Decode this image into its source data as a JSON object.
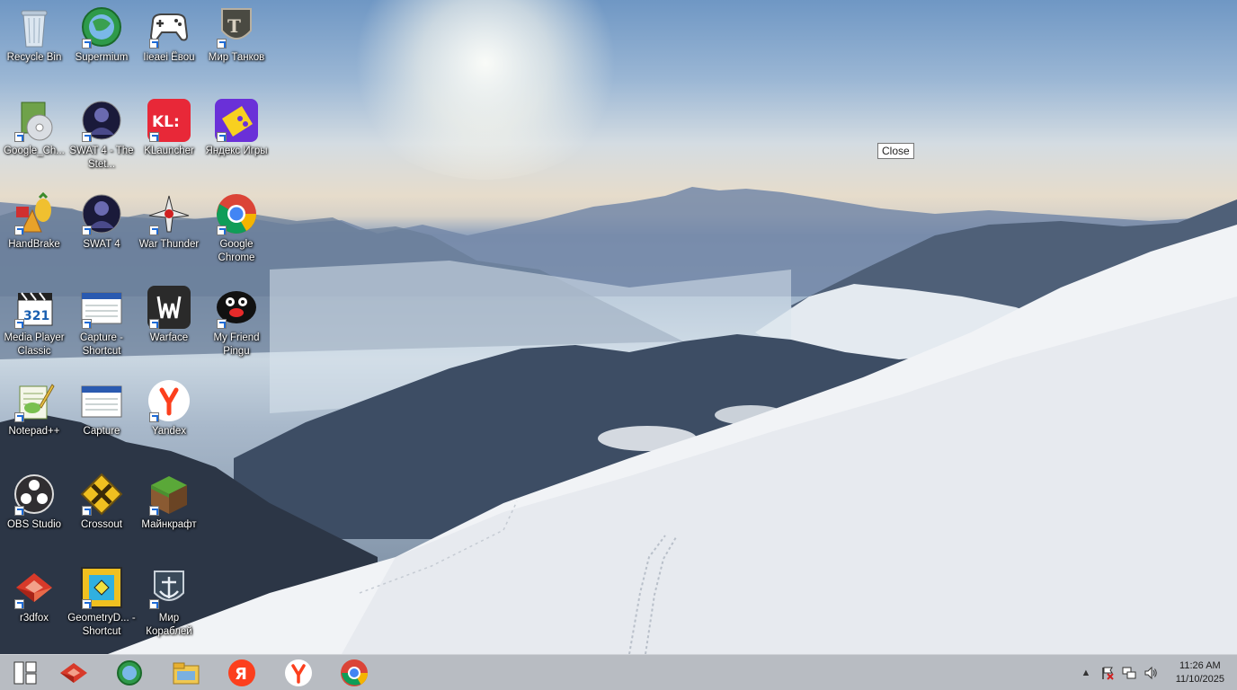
{
  "desktop": {
    "tooltip": "Close",
    "icons": [
      {
        "name": "Recycle Bin",
        "glyph": "recycle"
      },
      {
        "name": "Supermium",
        "glyph": "globe"
      },
      {
        "name": "Ііеаеі Ёвоu",
        "glyph": "gamepad"
      },
      {
        "name": "Мир Танков",
        "glyph": "tank"
      },
      {
        "name": "Google_Ch...",
        "glyph": "setup"
      },
      {
        "name": "SWAT 4 - The Stet...",
        "glyph": "swat"
      },
      {
        "name": "KLauncher",
        "glyph": "kl"
      },
      {
        "name": "Яндекс Игры",
        "glyph": "yagames"
      },
      {
        "name": "HandBrake",
        "glyph": "handbrake"
      },
      {
        "name": "SWAT 4",
        "glyph": "swat"
      },
      {
        "name": "War Thunder",
        "glyph": "warthunder"
      },
      {
        "name": "Google Chrome",
        "glyph": "chrome"
      },
      {
        "name": "Media Player Classic",
        "glyph": "mpc"
      },
      {
        "name": "Capture - Shortcut",
        "glyph": "window"
      },
      {
        "name": "Warface",
        "glyph": "warface"
      },
      {
        "name": "My Friend Pingu",
        "glyph": "pingu"
      },
      {
        "name": "Notepad++",
        "glyph": "notepad"
      },
      {
        "name": "Capture",
        "glyph": "window"
      },
      {
        "name": "Yandex",
        "glyph": "yandex"
      },
      {
        "name": "OBS Studio",
        "glyph": "obs"
      },
      {
        "name": "Crossout",
        "glyph": "crossout"
      },
      {
        "name": "Майнкрафт",
        "glyph": "minecraft"
      },
      {
        "name": "r3dfox",
        "glyph": "r3dfox"
      },
      {
        "name": "GeometryD... - Shortcut",
        "glyph": "geometry"
      },
      {
        "name": "Мир Кораблей",
        "glyph": "ships"
      }
    ]
  },
  "taskbar": {
    "items": [
      {
        "name": "start",
        "glyph": "start"
      },
      {
        "name": "r3dfox",
        "glyph": "r3dfox"
      },
      {
        "name": "supermium",
        "glyph": "globe"
      },
      {
        "name": "file-explorer",
        "glyph": "folder"
      },
      {
        "name": "yandex-browser",
        "glyph": "yaRed"
      },
      {
        "name": "yandex",
        "glyph": "yandex"
      },
      {
        "name": "google-chrome",
        "glyph": "chrome"
      }
    ],
    "clock": {
      "time": "11:26 AM",
      "date": "11/10/2025"
    }
  }
}
